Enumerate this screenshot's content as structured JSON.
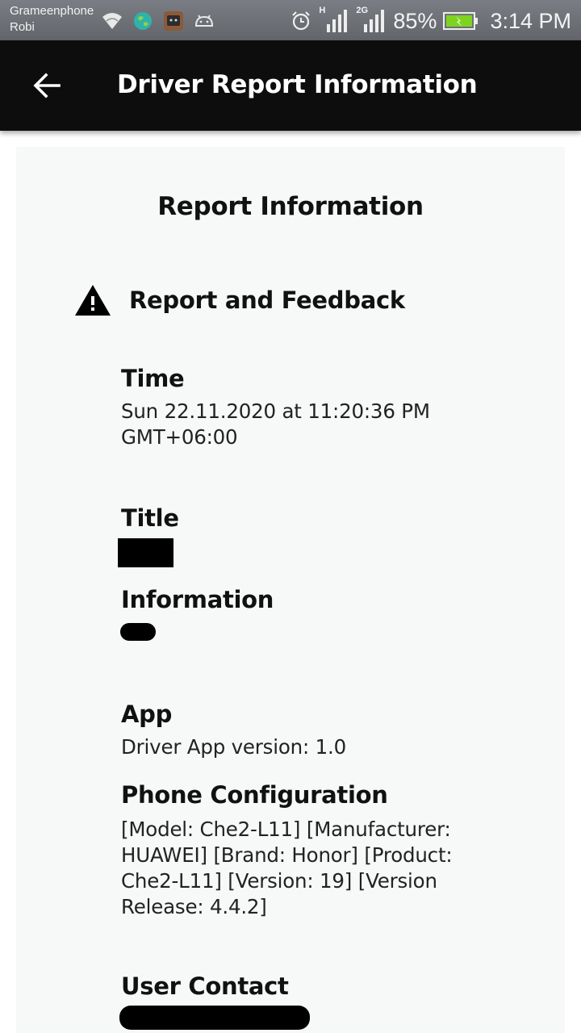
{
  "status_bar": {
    "carrier_line1": "Grameenphone",
    "carrier_line2": "Robi",
    "network_1_tag": "H",
    "network_2_tag": "2G",
    "battery_percent": "85%",
    "time": "3:14 PM",
    "icons": [
      "wifi-icon",
      "globe-icon",
      "app-notification-icon",
      "android-icon",
      "alarm-icon",
      "signal-icon",
      "signal-icon",
      "battery-charging-icon"
    ]
  },
  "app_bar": {
    "title": "Driver Report Information",
    "back_icon": "arrow-left-icon"
  },
  "report": {
    "heading": "Report Information",
    "section_title": "Report and Feedback",
    "section_icon": "warning-icon",
    "time_label": "Time",
    "time_value": "Sun 22.11.2020 at 11:20:36 PM GMT+06:00",
    "title_label": "Title",
    "information_label": "Information",
    "app_label": "App",
    "app_value": "Driver App version: 1.0",
    "phone_config_label": "Phone Configuration",
    "phone_config_value": "[Model: Che2-L11] [Manufacturer: HUAWEI] [Brand: Honor] [Product: Che2-L11] [Version: 19] [Version Release: 4.4.2]",
    "user_contact_label": "User Contact"
  },
  "colors": {
    "app_bar": "#0d0d0d",
    "status_bar": "#6c7075",
    "card_background": "#f6f9f8"
  }
}
